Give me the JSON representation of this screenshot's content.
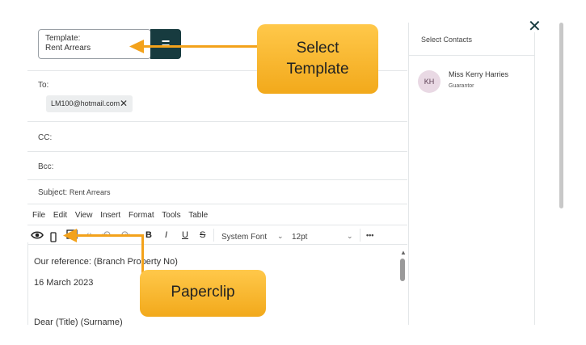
{
  "template": {
    "label": "Template:",
    "value": "Rent Arrears",
    "apply_icon": "equals-icon",
    "apply_glyph": "="
  },
  "close": {
    "glyph": "✕",
    "icon": "close-icon"
  },
  "to": {
    "label": "To:",
    "chip": "LM100@hotmail.com",
    "chip_remove": "✕"
  },
  "cc": {
    "label": "CC:"
  },
  "bcc": {
    "label": "Bcc:"
  },
  "subject": {
    "label": "Subject:",
    "value": "Rent Arrears"
  },
  "menu": [
    "File",
    "Edit",
    "View",
    "Insert",
    "Format",
    "Tools",
    "Table"
  ],
  "toolbar": {
    "font": "System Font",
    "size": "12pt",
    "more": "•••",
    "bold": "B",
    "italic": "I",
    "underline": "U",
    "strike": "S"
  },
  "editor": {
    "line1": "Our reference:   (Branch Property No)",
    "line2": "16 March 2023",
    "line3": "Dear    (Title)   (Surname)"
  },
  "contacts": {
    "header": "Select Contacts",
    "items": [
      {
        "initials": "KH",
        "name": "Miss Kerry Harries",
        "role": "Guarantor"
      }
    ]
  },
  "callouts": {
    "template": "Select\nTemplate",
    "paperclip": "Paperclip"
  },
  "colors": {
    "accent": "#173b3f",
    "callout": "#f5b02a",
    "arrow": "#f3a21b"
  }
}
